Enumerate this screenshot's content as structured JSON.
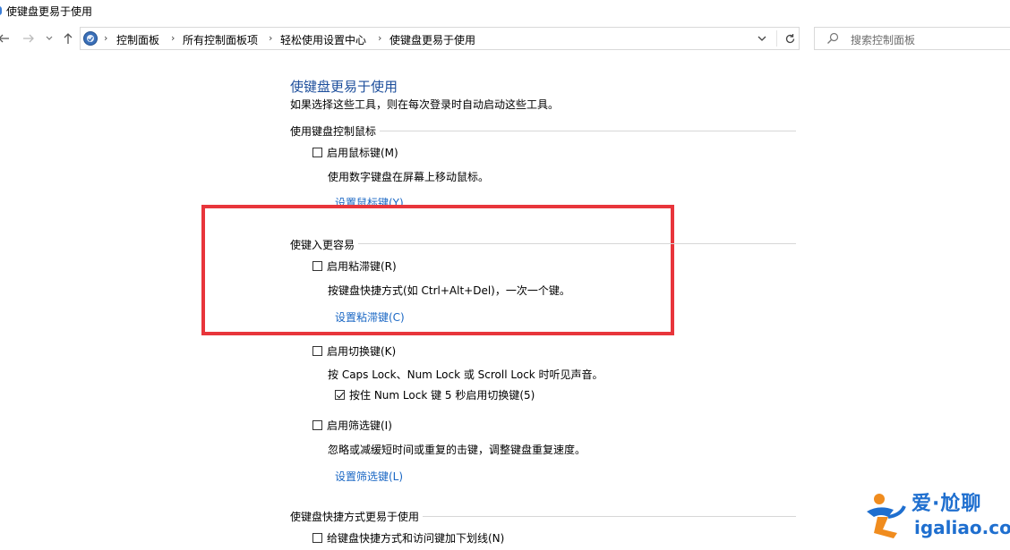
{
  "window": {
    "title": "使键盘更易于使用"
  },
  "nav": {
    "breadcrumb": [
      "控制面板",
      "所有控制面板项",
      "轻松使用设置中心",
      "使键盘更易于使用"
    ],
    "search_placeholder": "搜索控制面板"
  },
  "main": {
    "heading": "使键盘更易于使用",
    "subtitle": "如果选择这些工具，则在每次登录时自动启动这些工具。",
    "sections": [
      {
        "title": "使用键盘控制鼠标",
        "items": [
          {
            "checkbox": "启用鼠标键(M)",
            "checked": false,
            "description": "使用数字键盘在屏幕上移动鼠标。",
            "link": "设置鼠标键(Y)"
          }
        ]
      },
      {
        "title": "使键入更容易",
        "items": [
          {
            "checkbox": "启用粘滞键(R)",
            "checked": false,
            "description": "按键盘快捷方式(如 Ctrl+Alt+Del)，一次一个键。",
            "link": "设置粘滞键(C)"
          },
          {
            "checkbox": "启用切换键(K)",
            "checked": false,
            "description": "按 Caps Lock、Num Lock 或 Scroll Lock 时听见声音。",
            "sub_checkbox": "按住 Num Lock 键 5 秒启用切换键(5)",
            "sub_checked": true
          },
          {
            "checkbox": "启用筛选键(I)",
            "checked": false,
            "description": "忽略或减缓短时间或重复的击键，调整键盘重复速度。",
            "link": "设置筛选键(L)"
          }
        ]
      },
      {
        "title": "使键盘快捷方式更易于使用",
        "items": [
          {
            "checkbox": "给键盘快捷方式和访问键加下划线(N)",
            "checked": false
          }
        ]
      }
    ]
  },
  "watermark": {
    "title": "爱·尬聊",
    "url": "igaliao.com"
  },
  "colors": {
    "heading": "#1e4f9c",
    "link": "#1a67c4",
    "highlight": "#e8353b",
    "watermark": "#1f6fcf"
  }
}
